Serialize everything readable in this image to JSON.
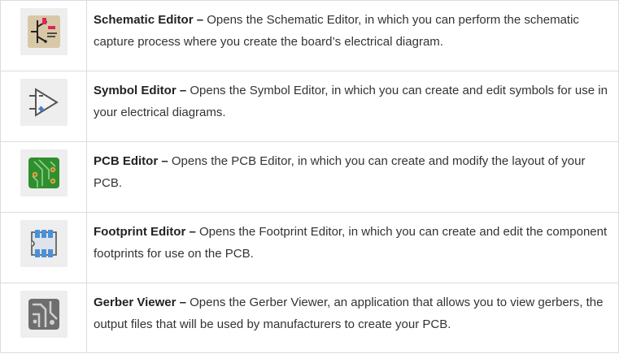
{
  "rows": [
    {
      "icon": "schematic-editor-icon",
      "title": "Schematic Editor –",
      "desc": " Opens the Schematic Editor, in which you can perform the schematic capture process where you create the board’s electrical diagram."
    },
    {
      "icon": "symbol-editor-icon",
      "title": "Symbol Editor –",
      "desc": " Opens the Symbol Editor, in which you can create and edit symbols for use in your electrical diagrams."
    },
    {
      "icon": "pcb-editor-icon",
      "title": "PCB Editor –",
      "desc": " Opens the PCB Editor, in which you can create and modify the layout of your PCB."
    },
    {
      "icon": "footprint-editor-icon",
      "title": "Footprint Editor –",
      "desc": " Opens the Footprint Editor, in which you can create and edit the component footprints for use on the PCB."
    },
    {
      "icon": "gerber-viewer-icon",
      "title": "Gerber Viewer –",
      "desc": " Opens the Gerber Viewer, an application that allows you to view gerbers, the output files that will be used by manufacturers to create your PCB."
    }
  ],
  "colors": {
    "border": "#dcdcdc",
    "icon_bg": "#eeeeee",
    "text": "#333333",
    "schematic_bg": "#d8c8a8",
    "schematic_accent": "#e0245e",
    "symbol_plus": "#3a7bd5",
    "pcb_green": "#2f8f2f",
    "pcb_pad": "#e8a23a",
    "footprint_blue": "#4a90d9",
    "gerber_gray": "#6e6e6e"
  }
}
